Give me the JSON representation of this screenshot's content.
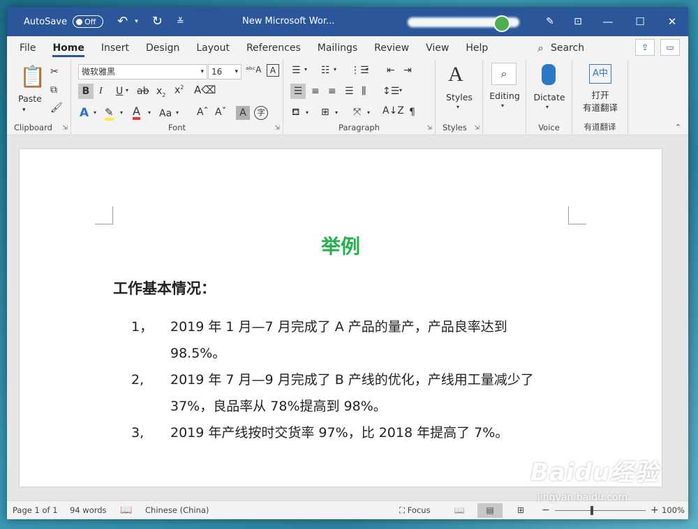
{
  "titlebar": {
    "autosave_label": "AutoSave",
    "autosave_state": "Off",
    "undo_icon": "undo-icon",
    "redo_icon": "redo-icon",
    "customize_icon": "customize-qat-icon",
    "doc_title": "New Microsoft Wor...",
    "accent": "#2b579a"
  },
  "tabs": [
    "File",
    "Home",
    "Insert",
    "Design",
    "Layout",
    "References",
    "Mailings",
    "Review",
    "View",
    "Help"
  ],
  "active_tab": "Home",
  "search_label": "Search",
  "ribbon": {
    "clipboard": {
      "paste_label": "Paste",
      "group_label": "Clipboard"
    },
    "font": {
      "font_name": "微软雅黑",
      "font_size": "16",
      "group_label": "Font",
      "bold": "B",
      "italic": "I",
      "underline": "U",
      "strike": "ab",
      "subscript": "x",
      "superscript": "x",
      "change_case": "Aa"
    },
    "paragraph": {
      "group_label": "Paragraph"
    },
    "styles": {
      "label": "Styles",
      "group_label": "Styles"
    },
    "editing": {
      "label": "Editing"
    },
    "voice": {
      "label": "Dictate",
      "group_label": "Voice"
    },
    "translate": {
      "label_line1": "打开",
      "label_line2": "有道翻译",
      "group_label": "有道翻译"
    }
  },
  "document": {
    "heading": "举例",
    "heading_color": "#22b14c",
    "section_heading": "工作基本情况：",
    "items": [
      {
        "num": "1，",
        "lines": [
          "2019 年 1 月—7 月完成了 A 产品的量产，产品良率达到",
          "98.5%。"
        ]
      },
      {
        "num": "2,",
        "lines": [
          "2019 年 7 月—9 月完成了 B 产线的优化，产线用工量减少了",
          "37%，良品率从 78%提高到 98%。"
        ]
      },
      {
        "num": "3,",
        "lines": [
          "2019 年产线按时交货率 97%，比 2018 年提高了 7%。"
        ]
      }
    ]
  },
  "statusbar": {
    "page": "Page 1 of 1",
    "words": "94 words",
    "language": "Chinese (China)",
    "focus": "Focus",
    "zoom": "100%"
  },
  "watermark": {
    "brand": "Baidu经验",
    "url": "jingyan.baidu.com"
  }
}
